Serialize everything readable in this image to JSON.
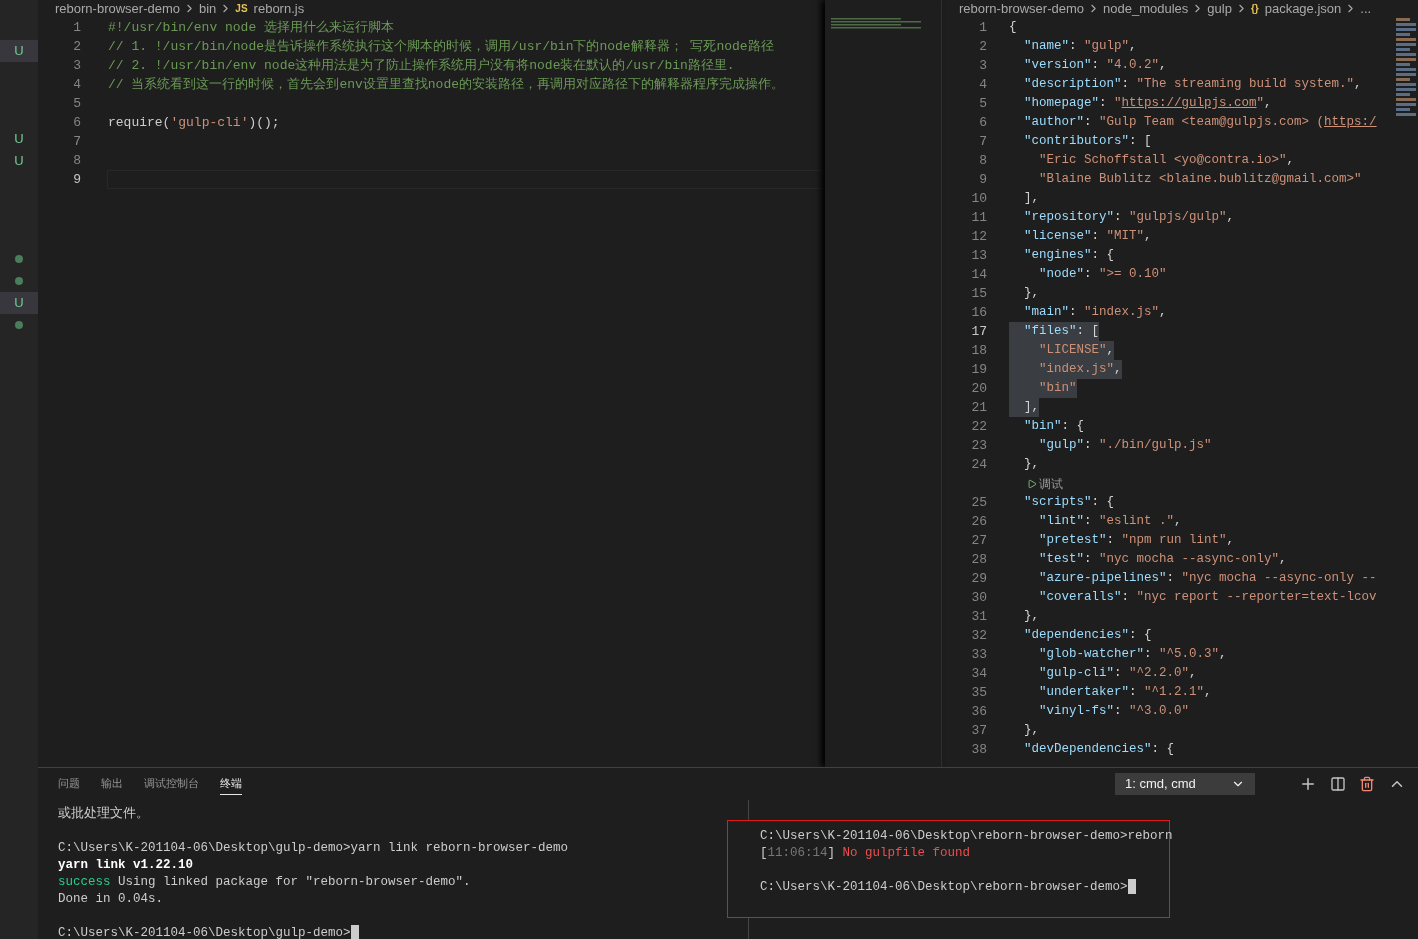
{
  "sidebar": {
    "groups": [
      {
        "items": [
          {
            "kind": "letter",
            "label": "U",
            "selected": true
          }
        ]
      },
      {
        "items": [
          {
            "kind": "letter",
            "label": "U",
            "selected": false
          },
          {
            "kind": "letter",
            "label": "U",
            "selected": false
          }
        ]
      },
      {
        "items": [
          {
            "kind": "dot",
            "selected": false
          },
          {
            "kind": "dot",
            "selected": false
          },
          {
            "kind": "letter",
            "label": "U",
            "selected": true
          },
          {
            "kind": "dot",
            "selected": false
          }
        ]
      }
    ]
  },
  "left_editor": {
    "breadcrumb": [
      {
        "kind": "text",
        "label": "reborn-browser-demo"
      },
      {
        "kind": "text",
        "label": "bin"
      },
      {
        "kind": "file",
        "icon": "JS",
        "label": "reborn.js"
      }
    ],
    "lines": [
      {
        "number": "1",
        "kind": "code",
        "active": false,
        "parts": [
          {
            "kind": "comment",
            "text": "#!/usr/bin/env node 选择用什么来运行脚本"
          }
        ]
      },
      {
        "number": "2",
        "kind": "code",
        "active": false,
        "parts": [
          {
            "kind": "comment",
            "text": "// 1. !/usr/bin/node是告诉操作系统执行这个脚本的时候，调用/usr/bin下的node解释器； 写死node路径"
          }
        ]
      },
      {
        "number": "3",
        "kind": "code",
        "active": false,
        "parts": [
          {
            "kind": "comment",
            "text": "// 2. !/usr/bin/env node这种用法是为了防止操作系统用户没有将node装在默认的/usr/bin路径里."
          }
        ]
      },
      {
        "number": "4",
        "kind": "code",
        "active": false,
        "parts": [
          {
            "kind": "comment",
            "text": "// 当系统看到这一行的时候，首先会到env设置里查找node的安装路径，再调用对应路径下的解释器程序完成操作。"
          }
        ]
      },
      {
        "number": "5",
        "kind": "blank",
        "active": false
      },
      {
        "number": "6",
        "kind": "code",
        "active": false,
        "parts": [
          {
            "kind": "plain",
            "text": "require("
          },
          {
            "kind": "string",
            "text": "'gulp-cli'"
          },
          {
            "kind": "plain",
            "text": ")();"
          }
        ]
      },
      {
        "number": "7",
        "kind": "blank",
        "active": false
      },
      {
        "number": "8",
        "kind": "blank",
        "active": false
      },
      {
        "number": "9",
        "kind": "blank",
        "active": true
      }
    ]
  },
  "right_editor": {
    "breadcrumb": [
      {
        "kind": "text",
        "label": "reborn-browser-demo"
      },
      {
        "kind": "text",
        "label": "node_modules"
      },
      {
        "kind": "text",
        "label": "gulp"
      },
      {
        "kind": "file",
        "icon": "{}",
        "label": "package.json"
      },
      {
        "kind": "text",
        "label": "..."
      }
    ],
    "lines": [
      {
        "number": "1",
        "kind": "code",
        "active": false,
        "selected": false,
        "parts": [
          {
            "kind": "punct",
            "text": "{"
          }
        ]
      },
      {
        "number": "2",
        "kind": "code",
        "active": false,
        "selected": false,
        "parts": [
          {
            "kind": "key",
            "text": "  \"name\""
          },
          {
            "kind": "punct",
            "text": ": "
          },
          {
            "kind": "string",
            "text": "\"gulp\""
          },
          {
            "kind": "punct",
            "text": ","
          }
        ]
      },
      {
        "number": "3",
        "kind": "code",
        "active": false,
        "selected": false,
        "parts": [
          {
            "kind": "key",
            "text": "  \"version\""
          },
          {
            "kind": "punct",
            "text": ": "
          },
          {
            "kind": "string",
            "text": "\"4.0.2\""
          },
          {
            "kind": "punct",
            "text": ","
          }
        ]
      },
      {
        "number": "4",
        "kind": "code",
        "active": false,
        "selected": false,
        "parts": [
          {
            "kind": "key",
            "text": "  \"description\""
          },
          {
            "kind": "punct",
            "text": ": "
          },
          {
            "kind": "string",
            "text": "\"The streaming build system.\""
          },
          {
            "kind": "punct",
            "text": ","
          }
        ]
      },
      {
        "number": "5",
        "kind": "code",
        "active": false,
        "selected": false,
        "parts": [
          {
            "kind": "key",
            "text": "  \"homepage\""
          },
          {
            "kind": "punct",
            "text": ": "
          },
          {
            "kind": "string",
            "text": "\""
          },
          {
            "kind": "link",
            "text": "https://gulpjs.com"
          },
          {
            "kind": "string",
            "text": "\""
          },
          {
            "kind": "punct",
            "text": ","
          }
        ]
      },
      {
        "number": "6",
        "kind": "code",
        "active": false,
        "selected": false,
        "parts": [
          {
            "kind": "key",
            "text": "  \"author\""
          },
          {
            "kind": "punct",
            "text": ": "
          },
          {
            "kind": "string",
            "text": "\"Gulp Team <team@gulpjs.com> ("
          },
          {
            "kind": "link",
            "text": "https:/"
          }
        ]
      },
      {
        "number": "7",
        "kind": "code",
        "active": false,
        "selected": false,
        "parts": [
          {
            "kind": "key",
            "text": "  \"contributors\""
          },
          {
            "kind": "punct",
            "text": ": ["
          }
        ]
      },
      {
        "number": "8",
        "kind": "code",
        "active": false,
        "selected": false,
        "parts": [
          {
            "kind": "string",
            "text": "    \"Eric Schoffstall <yo@contra.io>\""
          },
          {
            "kind": "punct",
            "text": ","
          }
        ]
      },
      {
        "number": "9",
        "kind": "code",
        "active": false,
        "selected": false,
        "parts": [
          {
            "kind": "string",
            "text": "    \"Blaine Bublitz <blaine.bublitz@gmail.com>\""
          }
        ]
      },
      {
        "number": "10",
        "kind": "code",
        "active": false,
        "selected": false,
        "parts": [
          {
            "kind": "punct",
            "text": "  ],"
          }
        ]
      },
      {
        "number": "11",
        "kind": "code",
        "active": false,
        "selected": false,
        "parts": [
          {
            "kind": "key",
            "text": "  \"repository\""
          },
          {
            "kind": "punct",
            "text": ": "
          },
          {
            "kind": "string",
            "text": "\"gulpjs/gulp\""
          },
          {
            "kind": "punct",
            "text": ","
          }
        ]
      },
      {
        "number": "12",
        "kind": "code",
        "active": false,
        "selected": false,
        "parts": [
          {
            "kind": "key",
            "text": "  \"license\""
          },
          {
            "kind": "punct",
            "text": ": "
          },
          {
            "kind": "string",
            "text": "\"MIT\""
          },
          {
            "kind": "punct",
            "text": ","
          }
        ]
      },
      {
        "number": "13",
        "kind": "code",
        "active": false,
        "selected": false,
        "parts": [
          {
            "kind": "key",
            "text": "  \"engines\""
          },
          {
            "kind": "punct",
            "text": ": {"
          }
        ]
      },
      {
        "number": "14",
        "kind": "code",
        "active": false,
        "selected": false,
        "parts": [
          {
            "kind": "key",
            "text": "    \"node\""
          },
          {
            "kind": "punct",
            "text": ": "
          },
          {
            "kind": "string",
            "text": "\">= 0.10\""
          }
        ]
      },
      {
        "number": "15",
        "kind": "code",
        "active": false,
        "selected": false,
        "parts": [
          {
            "kind": "punct",
            "text": "  },"
          }
        ]
      },
      {
        "number": "16",
        "kind": "code",
        "active": false,
        "selected": false,
        "parts": [
          {
            "kind": "key",
            "text": "  \"main\""
          },
          {
            "kind": "punct",
            "text": ": "
          },
          {
            "kind": "string",
            "text": "\"index.js\""
          },
          {
            "kind": "punct",
            "text": ","
          }
        ]
      },
      {
        "number": "17",
        "kind": "code",
        "active": true,
        "selected": true,
        "parts": [
          {
            "kind": "key",
            "text": "  \"files\""
          },
          {
            "kind": "punct",
            "text": ": ["
          }
        ]
      },
      {
        "number": "18",
        "kind": "code",
        "active": false,
        "selected": true,
        "parts": [
          {
            "kind": "string",
            "text": "    \"LICENSE\""
          },
          {
            "kind": "punct",
            "text": ","
          }
        ]
      },
      {
        "number": "19",
        "kind": "code",
        "active": false,
        "selected": true,
        "parts": [
          {
            "kind": "string",
            "text": "    \"index.js\""
          },
          {
            "kind": "punct",
            "text": ","
          }
        ]
      },
      {
        "number": "20",
        "kind": "code",
        "active": false,
        "selected": true,
        "parts": [
          {
            "kind": "string",
            "text": "    \"bin\""
          }
        ]
      },
      {
        "number": "21",
        "kind": "code",
        "active": false,
        "selected": true,
        "parts": [
          {
            "kind": "punct",
            "text": "  ],"
          }
        ]
      },
      {
        "number": "22",
        "kind": "code",
        "active": false,
        "selected": false,
        "parts": [
          {
            "kind": "key",
            "text": "  \"bin\""
          },
          {
            "kind": "punct",
            "text": ": {"
          }
        ]
      },
      {
        "number": "23",
        "kind": "code",
        "active": false,
        "selected": false,
        "parts": [
          {
            "kind": "key",
            "text": "    \"gulp\""
          },
          {
            "kind": "punct",
            "text": ": "
          },
          {
            "kind": "string",
            "text": "\"./bin/gulp.js\""
          }
        ]
      },
      {
        "number": "24",
        "kind": "code",
        "active": false,
        "selected": false,
        "parts": [
          {
            "kind": "punct",
            "text": "  },"
          }
        ]
      },
      {
        "kind": "codelens",
        "label": "调试"
      },
      {
        "number": "25",
        "kind": "code",
        "active": false,
        "selected": false,
        "parts": [
          {
            "kind": "key",
            "text": "  \"scripts\""
          },
          {
            "kind": "punct",
            "text": ": {"
          }
        ]
      },
      {
        "number": "26",
        "kind": "code",
        "active": false,
        "selected": false,
        "parts": [
          {
            "kind": "key",
            "text": "    \"lint\""
          },
          {
            "kind": "punct",
            "text": ": "
          },
          {
            "kind": "string",
            "text": "\"eslint .\""
          },
          {
            "kind": "punct",
            "text": ","
          }
        ]
      },
      {
        "number": "27",
        "kind": "code",
        "active": false,
        "selected": false,
        "parts": [
          {
            "kind": "key",
            "text": "    \"pretest\""
          },
          {
            "kind": "punct",
            "text": ": "
          },
          {
            "kind": "string",
            "text": "\"npm run lint\""
          },
          {
            "kind": "punct",
            "text": ","
          }
        ]
      },
      {
        "number": "28",
        "kind": "code",
        "active": false,
        "selected": false,
        "parts": [
          {
            "kind": "key",
            "text": "    \"test\""
          },
          {
            "kind": "punct",
            "text": ": "
          },
          {
            "kind": "string",
            "text": "\"nyc mocha --async-only\""
          },
          {
            "kind": "punct",
            "text": ","
          }
        ]
      },
      {
        "number": "29",
        "kind": "code",
        "active": false,
        "selected": false,
        "parts": [
          {
            "kind": "key",
            "text": "    \"azure-pipelines\""
          },
          {
            "kind": "punct",
            "text": ": "
          },
          {
            "kind": "string",
            "text": "\"nyc mocha --async-only --"
          }
        ]
      },
      {
        "number": "30",
        "kind": "code",
        "active": false,
        "selected": false,
        "parts": [
          {
            "kind": "key",
            "text": "    \"coveralls\""
          },
          {
            "kind": "punct",
            "text": ": "
          },
          {
            "kind": "string",
            "text": "\"nyc report --reporter=text-lcov"
          }
        ]
      },
      {
        "number": "31",
        "kind": "code",
        "active": false,
        "selected": false,
        "parts": [
          {
            "kind": "punct",
            "text": "  },"
          }
        ]
      },
      {
        "number": "32",
        "kind": "code",
        "active": false,
        "selected": false,
        "parts": [
          {
            "kind": "key",
            "text": "  \"dependencies\""
          },
          {
            "kind": "punct",
            "text": ": {"
          }
        ]
      },
      {
        "number": "33",
        "kind": "code",
        "active": false,
        "selected": false,
        "parts": [
          {
            "kind": "key",
            "text": "    \"glob-watcher\""
          },
          {
            "kind": "punct",
            "text": ": "
          },
          {
            "kind": "string",
            "text": "\"^5.0.3\""
          },
          {
            "kind": "punct",
            "text": ","
          }
        ]
      },
      {
        "number": "34",
        "kind": "code",
        "active": false,
        "selected": false,
        "parts": [
          {
            "kind": "key",
            "text": "    \"gulp-cli\""
          },
          {
            "kind": "punct",
            "text": ": "
          },
          {
            "kind": "string",
            "text": "\"^2.2.0\""
          },
          {
            "kind": "punct",
            "text": ","
          }
        ]
      },
      {
        "number": "35",
        "kind": "code",
        "active": false,
        "selected": false,
        "parts": [
          {
            "kind": "key",
            "text": "    \"undertaker\""
          },
          {
            "kind": "punct",
            "text": ": "
          },
          {
            "kind": "string",
            "text": "\"^1.2.1\""
          },
          {
            "kind": "punct",
            "text": ","
          }
        ]
      },
      {
        "number": "36",
        "kind": "code",
        "active": false,
        "selected": false,
        "parts": [
          {
            "kind": "key",
            "text": "    \"vinyl-fs\""
          },
          {
            "kind": "punct",
            "text": ": "
          },
          {
            "kind": "string",
            "text": "\"^3.0.0\""
          }
        ]
      },
      {
        "number": "37",
        "kind": "code",
        "active": false,
        "selected": false,
        "parts": [
          {
            "kind": "punct",
            "text": "  },"
          }
        ]
      },
      {
        "number": "38",
        "kind": "code",
        "active": false,
        "selected": false,
        "parts": [
          {
            "kind": "key",
            "text": "  \"devDependencies\""
          },
          {
            "kind": "punct",
            "text": ": {"
          }
        ]
      }
    ]
  },
  "panel": {
    "tabs": [
      {
        "label": "问题",
        "selected": false
      },
      {
        "label": "输出",
        "selected": false
      },
      {
        "label": "调试控制台",
        "selected": false
      },
      {
        "label": "终端",
        "selected": true
      }
    ],
    "terminal_select": "1: cmd, cmd",
    "left_pane": {
      "outlined": false,
      "lines": [
        {
          "kind": "text",
          "parts": [
            {
              "kind": "plain",
              "text": "或批处理文件。"
            }
          ]
        },
        {
          "kind": "blank"
        },
        {
          "kind": "text",
          "parts": [
            {
              "kind": "plain",
              "text": "C:\\Users\\K-201104-06\\Desktop\\gulp-demo>yarn link reborn-browser-demo"
            }
          ]
        },
        {
          "kind": "text",
          "parts": [
            {
              "kind": "bold",
              "text": "yarn link v1.22.10"
            }
          ]
        },
        {
          "kind": "text",
          "parts": [
            {
              "kind": "green",
              "text": "success"
            },
            {
              "kind": "plain",
              "text": " Using linked package for \"reborn-browser-demo\"."
            }
          ]
        },
        {
          "kind": "text",
          "parts": [
            {
              "kind": "plain",
              "text": "Done in 0.04s."
            }
          ]
        },
        {
          "kind": "blank"
        },
        {
          "kind": "text",
          "cursor": true,
          "parts": [
            {
              "kind": "plain",
              "text": "C:\\Users\\K-201104-06\\Desktop\\gulp-demo>"
            }
          ]
        }
      ]
    },
    "right_pane": {
      "outlined": true,
      "lines": [
        {
          "kind": "text",
          "parts": [
            {
              "kind": "plain",
              "text": "C:\\Users\\K-201104-06\\Desktop\\reborn-browser-demo>reborn"
            }
          ]
        },
        {
          "kind": "text",
          "parts": [
            {
              "kind": "plain",
              "text": "["
            },
            {
              "kind": "gray",
              "text": "11:06:14"
            },
            {
              "kind": "plain",
              "text": "] "
            },
            {
              "kind": "red",
              "text": "No gulpfile found"
            }
          ]
        },
        {
          "kind": "blank"
        },
        {
          "kind": "text",
          "cursor": true,
          "parts": [
            {
              "kind": "plain",
              "text": "C:\\Users\\K-201104-06\\Desktop\\reborn-browser-demo>"
            }
          ]
        }
      ]
    }
  }
}
